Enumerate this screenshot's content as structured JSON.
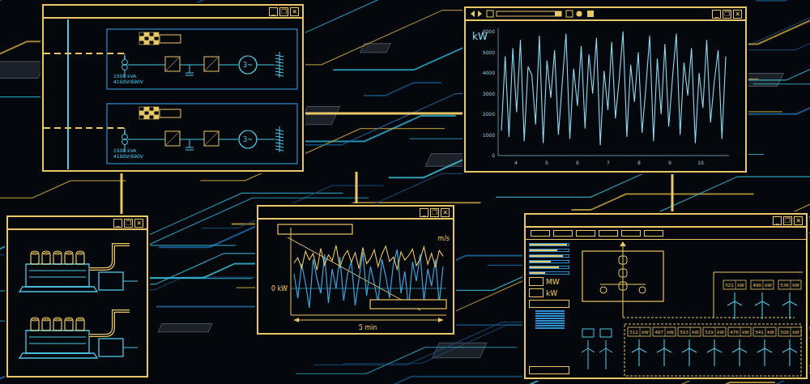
{
  "window_controls": [
    "_",
    "❐",
    "✕"
  ],
  "diagram_window": {
    "units": [
      {
        "rating": "1500 kVA",
        "voltage": "4160V/690V",
        "motor": "3~"
      },
      {
        "rating": "1500 kVA",
        "voltage": "4160V/690V",
        "motor": "3~"
      }
    ]
  },
  "power_chart": {
    "unit": "kW",
    "y_ticks": [
      "6000",
      "5000",
      "4000",
      "3000",
      "2000",
      "1000",
      "0"
    ],
    "x_ticks": [
      "4",
      "5",
      "6",
      "7",
      "8",
      "9",
      "10"
    ],
    "values": [
      1200,
      4800,
      900,
      5200,
      2100,
      5600,
      700,
      4300,
      3900,
      1500,
      5800,
      600,
      4600,
      2800,
      5100,
      1000,
      3500,
      5900,
      800,
      4200,
      2400,
      5300,
      1300,
      4900,
      3000,
      5700,
      500,
      4100,
      2200,
      5500,
      1800,
      3700,
      6000,
      900,
      4400,
      2600,
      5000,
      1100,
      3300,
      5800,
      700,
      4700,
      2000,
      5400,
      1400,
      3800,
      5900,
      1000,
      4500,
      2900,
      5200,
      600,
      4000,
      2300,
      5600,
      1600,
      3600,
      5100,
      800,
      4800
    ]
  },
  "wind_chart": {
    "zero_label": "0 kW",
    "speed_unit": "m/s",
    "span": "5 min",
    "power": [
      300,
      -200,
      500,
      100,
      -400,
      600,
      200,
      -100,
      700,
      -300,
      400,
      0,
      650,
      -250,
      300,
      550,
      -350,
      200,
      750,
      -150,
      450,
      100,
      -300,
      600,
      250,
      -200,
      500,
      800,
      -100,
      350,
      -400,
      550,
      150,
      700,
      -250,
      400,
      50,
      600,
      -300,
      450
    ],
    "wind": [
      8.5,
      9.2,
      7.8,
      10.1,
      8.9,
      9.8,
      7.5,
      10.5,
      8.2,
      9.6,
      8.8,
      10.9,
      7.9,
      9.4,
      10.2,
      8.6,
      9.9,
      7.7,
      10.6,
      8.4,
      9.1,
      10.3,
      8.0,
      9.7,
      10.8,
      8.7,
      9.3,
      7.6,
      10.0,
      8.9,
      9.5,
      10.4,
      8.1,
      9.0,
      10.7,
      8.3,
      9.8,
      7.9,
      10.2,
      9.4
    ]
  },
  "scada": {
    "meters": [
      {
        "level": 0.95
      },
      {
        "level": 0.7
      },
      {
        "level": 0.85
      },
      {
        "level": 0.55
      },
      {
        "level": 0.75
      },
      {
        "level": 0.4
      }
    ],
    "unit_labels": [
      "MW",
      "kW"
    ],
    "turbines": [
      {
        "reading": "521",
        "unit": "kW"
      },
      {
        "reading": "498",
        "unit": "kW"
      },
      {
        "reading": "536",
        "unit": "kW"
      },
      {
        "reading": "512",
        "unit": "kW"
      },
      {
        "reading": "487",
        "unit": "kW"
      },
      {
        "reading": "503",
        "unit": "kW"
      },
      {
        "reading": "529",
        "unit": "kW"
      },
      {
        "reading": "476",
        "unit": "kW"
      },
      {
        "reading": "541",
        "unit": "kW"
      },
      {
        "reading": "508",
        "unit": "kW"
      }
    ]
  }
}
